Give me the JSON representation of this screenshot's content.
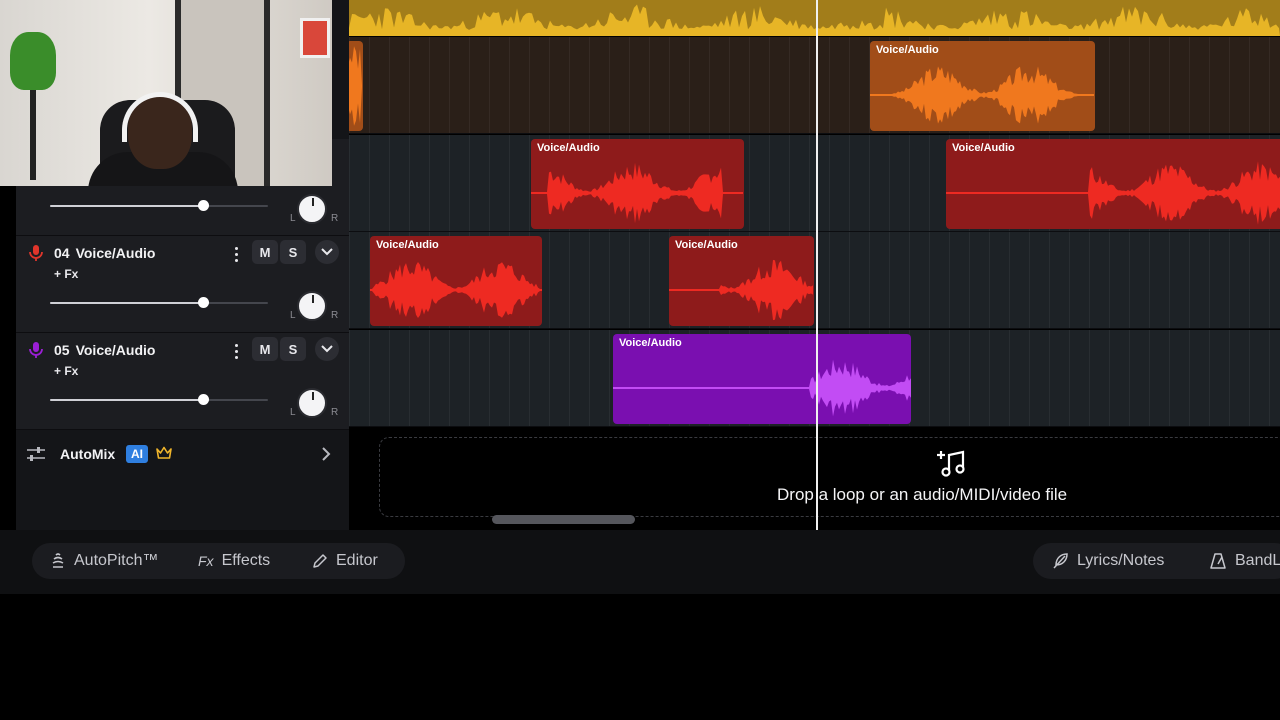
{
  "tracks": [
    {
      "number": "04",
      "name": "Voice/Audio",
      "mute_label": "M",
      "solo_label": "S",
      "fx_label": "+ Fx",
      "volume": 0.7,
      "pan_left": "L",
      "pan_right": "R",
      "mic_color": "#e0352b"
    },
    {
      "number": "05",
      "name": "Voice/Audio",
      "mute_label": "M",
      "solo_label": "S",
      "fx_label": "+ Fx",
      "volume": 0.7,
      "pan_left": "L",
      "pan_right": "R",
      "mic_color": "#9b1fd6"
    }
  ],
  "partial_track": {
    "volume": 0.7,
    "pan_left": "L",
    "pan_right": "R"
  },
  "automix": {
    "label": "AutoMix",
    "badge": "AI"
  },
  "clips": {
    "lane2": [
      {
        "label": "Voice/Audio"
      }
    ],
    "lane3": [
      {
        "label": "Voice/Audio"
      },
      {
        "label": "Voice/Audio"
      }
    ],
    "lane4": [
      {
        "label": "Voice/Audio"
      },
      {
        "label": "Voice/Audio"
      }
    ],
    "lane5": [
      {
        "label": "Voice/Audio"
      }
    ]
  },
  "dropzone": {
    "text": "Drop a loop or an audio/MIDI/video file"
  },
  "toolbar": {
    "autopitch": "AutoPitch™",
    "effects": "Effects",
    "effects_prefix": "Fx",
    "editor": "Editor",
    "lyrics": "Lyrics/Notes",
    "bandlab": "BandL"
  },
  "colors": {
    "master": "#a27d1a",
    "orange_clip": "#a14d18",
    "red_clip": "#8e1b1b",
    "purple_clip": "#7a0fb0",
    "ai_badge": "#2f7fe0"
  },
  "icons": [
    "mic-icon",
    "more-icon",
    "chevron-down-icon",
    "sliders-icon",
    "crown-icon",
    "chevron-right-icon",
    "music-add-icon",
    "autopitch-icon",
    "pencil-icon",
    "feather-icon",
    "metronome-icon"
  ]
}
